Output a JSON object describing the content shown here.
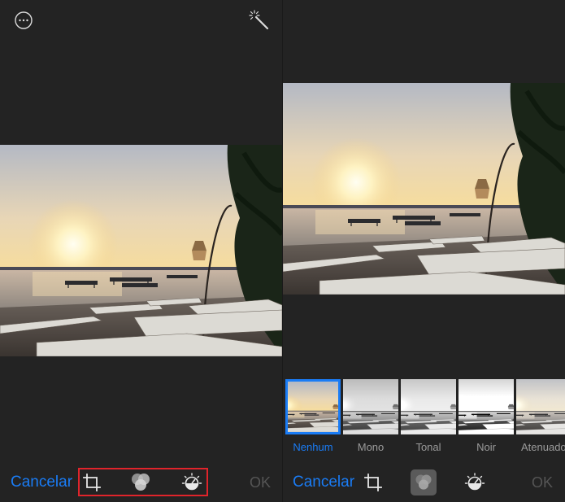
{
  "left_panel": {
    "cancel_label": "Cancelar",
    "ok_label": "OK",
    "top_icons": [
      "more-options-icon",
      "magic-wand-icon"
    ],
    "tools": [
      "crop-rotate-icon",
      "filters-icon",
      "adjust-light-icon"
    ]
  },
  "right_panel": {
    "cancel_label": "Cancelar",
    "ok_label": "OK",
    "filters": [
      {
        "label": "Nenhum",
        "selected": true
      },
      {
        "label": "Mono",
        "selected": false
      },
      {
        "label": "Tonal",
        "selected": false
      },
      {
        "label": "Noir",
        "selected": false
      },
      {
        "label": "Atenuado",
        "selected": false
      }
    ],
    "tools": [
      "crop-rotate-icon",
      "filters-icon",
      "adjust-light-icon"
    ]
  },
  "colors": {
    "accent": "#1a7cf5",
    "background": "#232323",
    "highlight_box": "#e0242b",
    "disabled_text": "#555555"
  }
}
